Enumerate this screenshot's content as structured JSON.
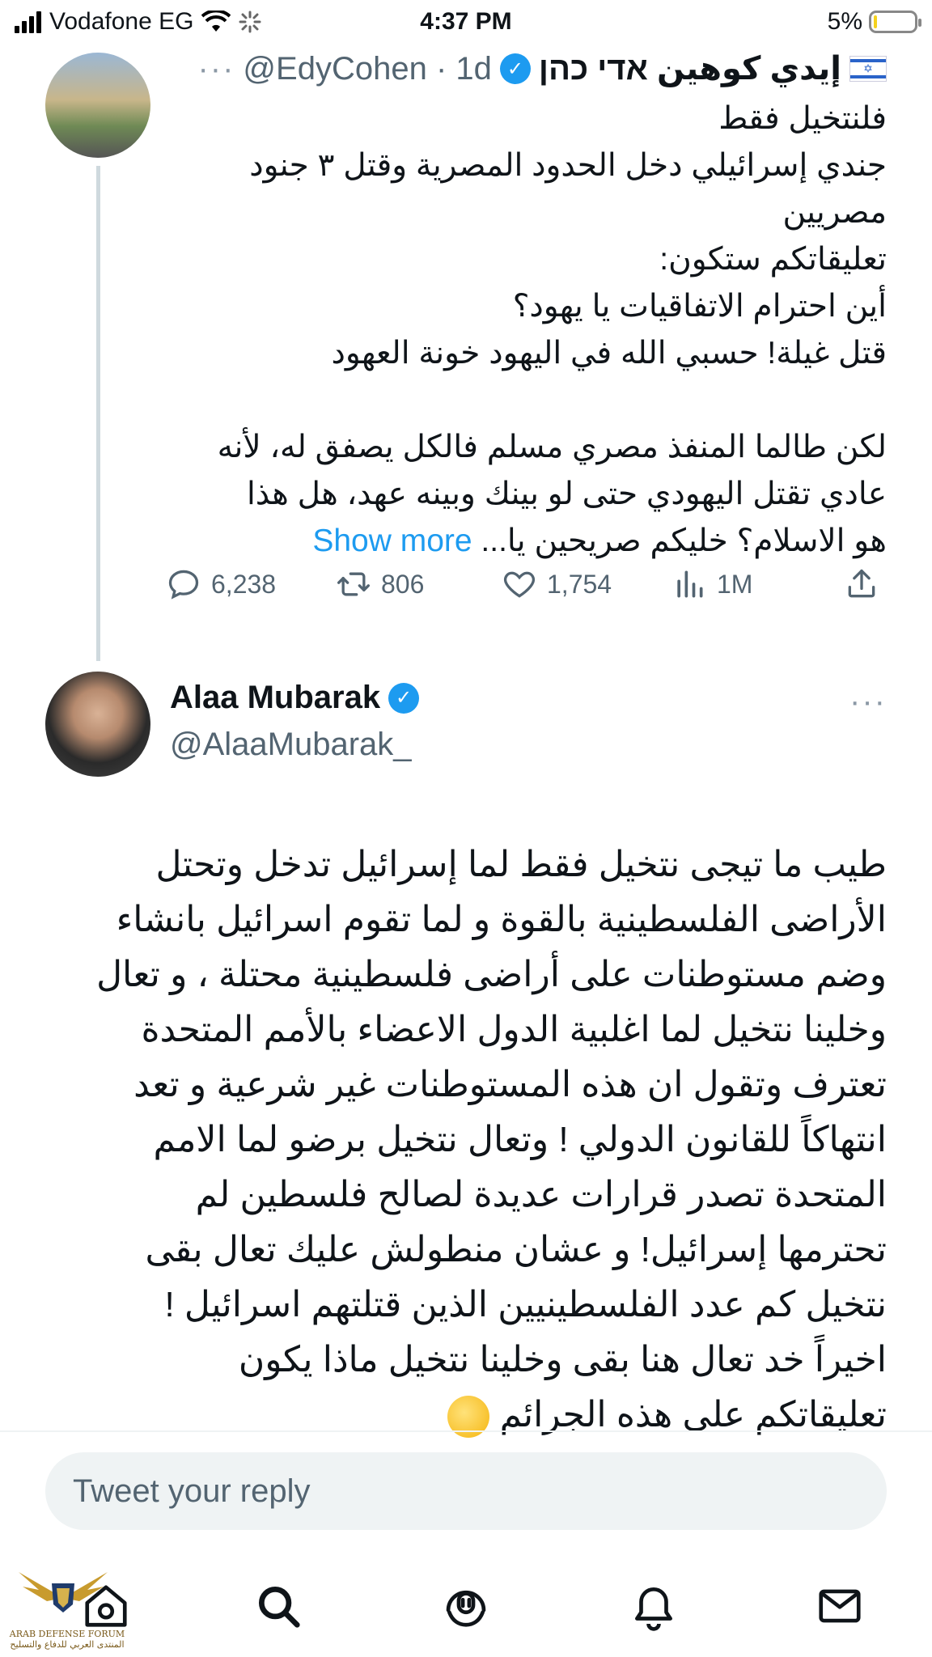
{
  "status_bar": {
    "carrier": "Vodafone EG",
    "time": "4:37 PM",
    "battery": "5%"
  },
  "tweet1": {
    "name": "إيدي كوهين אדי כהן",
    "handle": "@EdyCohen",
    "time": "· 1d",
    "lines": [
      "فلنتخيل فقط",
      "جندي إسرائيلي دخل الحدود المصرية وقتل ٣ جنود",
      "مصريين",
      "تعليقاتكم ستكون:",
      "أين احترام الاتفاقيات يا يهود؟",
      "قتل غيلة! حسبي الله في اليهود خونة العهود",
      "",
      "لكن طالما المنفذ مصري مسلم فالكل يصفق له، لأنه",
      "عادي تقتل اليهودي حتى لو بينك وبينه عهد، هل هذا"
    ],
    "last_line": "هو الاسلام؟ خليكم صريحين يا...",
    "show_more": "Show more",
    "replies": "6,238",
    "retweets": "806",
    "likes": "1,754",
    "views": "1M"
  },
  "tweet2": {
    "name": "Alaa Mubarak",
    "handle": "@AlaaMubarak_",
    "lines": [
      "طيب ما تيجى نتخيل فقط لما إسرائيل تدخل وتحتل",
      "الأراضى الفلسطينية بالقوة و لما تقوم اسرائيل بانشاء",
      "وضم مستوطنات على أراضى فلسطينية محتلة ، و تعال",
      "وخلينا نتخيل لما اغلبية الدول الاعضاء بالأمم المتحدة",
      "تعترف وتقول ان هذه المستوطنات غير شرعية و تعد",
      "انتهاكاً للقانون الدولي ! وتعال نتخيل برضو لما الامم",
      "المتحدة تصدر قرارات عديدة لصالح فلسطين لم",
      "تحترمها إسرائيل! و عشان منطولش عليك تعال بقى",
      "نتخيل كم عدد الفلسطينيين الذين قتلتهم اسرائيل !",
      "اخيراً خد تعال هنا بقى وخلينا نتخيل ماذا يكون"
    ],
    "last_line": "تعليقاتكم على هذه الجرائم"
  },
  "reply": {
    "placeholder": "Tweet your reply"
  },
  "watermark": {
    "line1": "ARAB DEFENSE FORUM",
    "line2": "المنتدى العربي للدفاع والتسليح"
  },
  "icons": [
    "signal-icon",
    "wifi-icon",
    "loading-icon",
    "battery-icon",
    "verified-icon",
    "israel-flag-icon",
    "more-icon",
    "reply-icon",
    "retweet-icon",
    "like-icon",
    "views-icon",
    "share-icon",
    "home-icon",
    "search-icon",
    "spaces-icon",
    "notifications-icon",
    "messages-icon",
    "thinking-emoji-icon"
  ],
  "colors": {
    "accent": "#1d9bf0",
    "secondary_text": "#536471",
    "divider": "#eff3f4"
  }
}
